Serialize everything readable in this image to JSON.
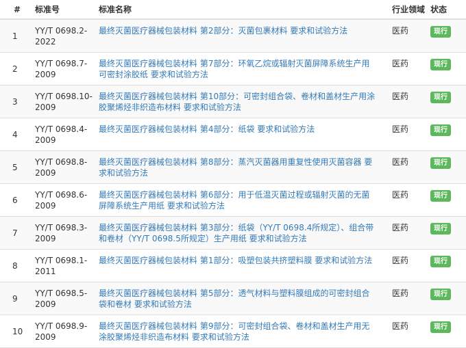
{
  "headers": {
    "num": "#",
    "code": "标准号",
    "name": "标准名称",
    "industry": "行业领域",
    "status": "状态"
  },
  "colors": {
    "link": "#337ab7",
    "badge": "#5cb85c",
    "stripe": "#f9f9f9"
  },
  "rows": [
    {
      "num": "1",
      "code": "YY/T 0698.2-2022",
      "name": "最终灭菌医疗器械包装材料 第2部分：灭菌包裹材料 要求和试验方法",
      "industry": "医药",
      "status": "现行"
    },
    {
      "num": "2",
      "code": "YY/T 0698.7-2009",
      "name": "最终灭菌医疗器械包装材料 第7部分：环氧乙烷或辐射灭菌屏障系统生产用可密封涂胶纸 要求和试验方法",
      "industry": "医药",
      "status": "现行"
    },
    {
      "num": "3",
      "code": "YY/T 0698.10-2009",
      "name": "最终灭菌医疗器械包装材料 第10部分：可密封组合袋、卷材和盖材生产用涂胶聚烯烃非织造布材料 要求和试验方法",
      "industry": "医药",
      "status": "现行"
    },
    {
      "num": "4",
      "code": "YY/T 0698.4-2009",
      "name": "最终灭菌医疗器械包装材料 第4部分：纸袋 要求和试验方法",
      "industry": "医药",
      "status": "现行"
    },
    {
      "num": "5",
      "code": "YY/T 0698.8-2009",
      "name": "最终灭菌医疗器械包装材料 第8部分：蒸汽灭菌器用重复性使用灭菌容器 要求和试验方法",
      "industry": "医药",
      "status": "现行"
    },
    {
      "num": "6",
      "code": "YY/T 0698.6-2009",
      "name": "最终灭菌医疗器械包装材料 第6部分：用于低温灭菌过程或辐射灭菌的无菌屏障系统生产用纸 要求和试验方法",
      "industry": "医药",
      "status": "现行"
    },
    {
      "num": "7",
      "code": "YY/T 0698.3-2009",
      "name": "最终灭菌医疗器械包装材料 第3部分：纸袋（YY/T 0698.4所规定）、组合带和卷材（YY/T 0698.5所规定）生产用纸 要求和试验方法",
      "industry": "医药",
      "status": "现行"
    },
    {
      "num": "8",
      "code": "YY/T 0698.1-2011",
      "name": "最终灭菌医疗器械包装材料 第1部分：吸塑包装共挤塑料膜 要求和试验方法",
      "industry": "医药",
      "status": "现行"
    },
    {
      "num": "9",
      "code": "YY/T 0698.5-2009",
      "name": "最终灭菌医疗器械包装材料 第5部分：透气材料与塑料膜组成的可密封组合袋和卷材 要求和试验方法",
      "industry": "医药",
      "status": "现行"
    },
    {
      "num": "10",
      "code": "YY/T 0698.9-2009",
      "name": "最终灭菌医疗器械包装材料 第9部分：可密封组合袋、卷材和盖材生产用无涂胶聚烯烃非织造布材料 要求和试验方法",
      "industry": "医药",
      "status": "现行"
    }
  ]
}
